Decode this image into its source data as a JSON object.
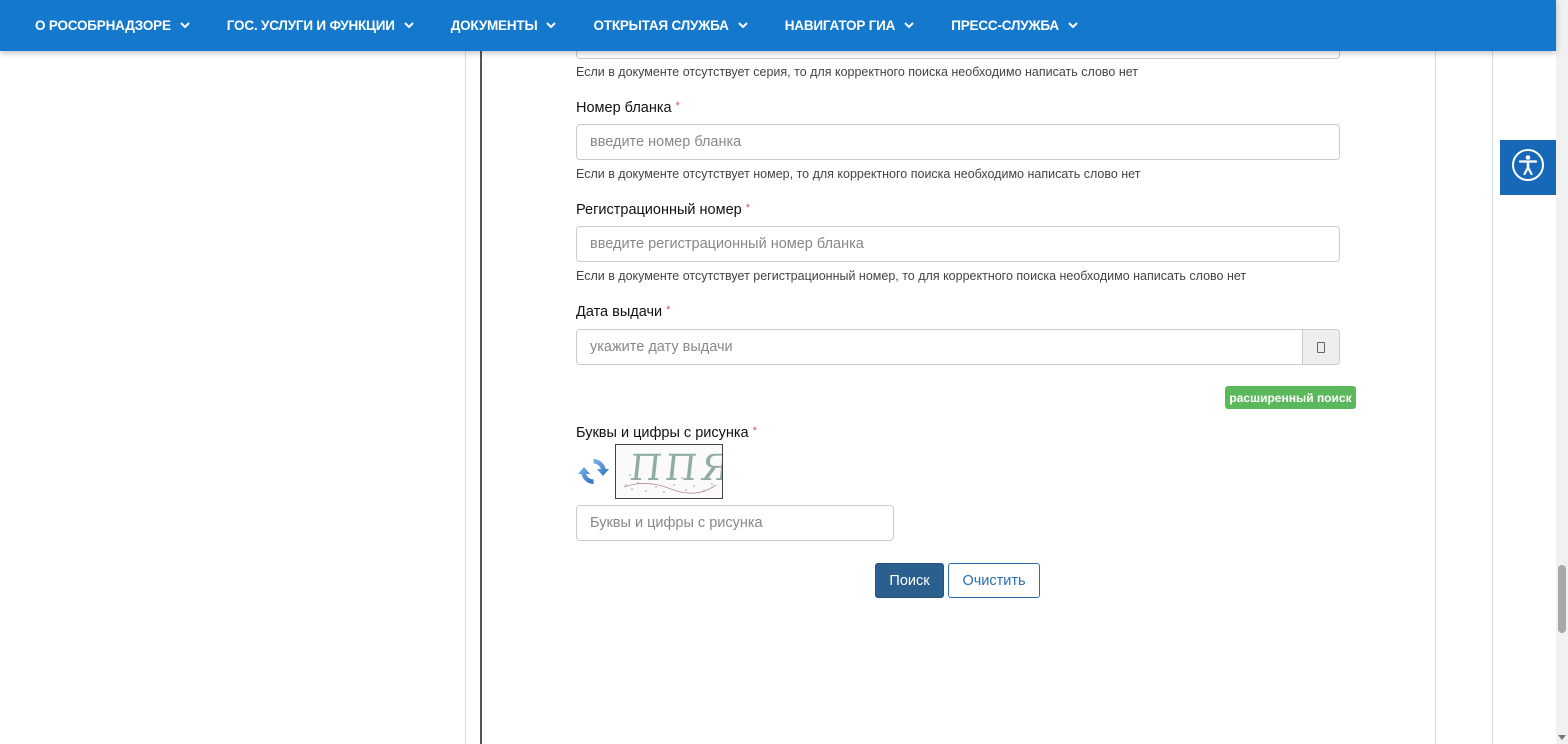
{
  "nav": {
    "items": [
      {
        "label": "О РОСОБРНАДЗОРЕ"
      },
      {
        "label": "ГОС. УСЛУГИ И ФУНКЦИИ"
      },
      {
        "label": "ДОКУМЕНТЫ"
      },
      {
        "label": "ОТКРЫТАЯ СЛУЖБА"
      },
      {
        "label": "НАВИГАТОР ГИА"
      },
      {
        "label": "ПРЕСС-СЛУЖБА"
      }
    ]
  },
  "form": {
    "series_hint": "Если в документе отсутствует серия, то для корректного поиска необходимо написать слово нет",
    "blank_number": {
      "label": "Номер бланка",
      "required_mark": "*",
      "placeholder": "введите номер бланка",
      "hint": "Если в документе отсутствует номер, то для корректного поиска необходимо написать слово нет"
    },
    "reg_number": {
      "label": "Регистрационный номер",
      "required_mark": "*",
      "placeholder": "введите регистрационный номер бланка",
      "hint": "Если в документе отсутствует регистрационный номер, то для корректного поиска необходимо написать слово нет"
    },
    "issue_date": {
      "label": "Дата выдачи",
      "required_mark": "*",
      "placeholder": "укажите дату выдачи"
    },
    "advanced_search_label": "расширенный поиск",
    "captcha": {
      "label": "Буквы и цифры с рисунка",
      "required_mark": "*",
      "placeholder": "Буквы и цифры с рисунка",
      "image_text": "ППЯ"
    },
    "search_button": "Поиск",
    "clear_button": "Очистить"
  },
  "colors": {
    "nav_bg": "#1478cc",
    "accessibility_bg": "#1769b7",
    "advanced_search_bg": "#5cb85c",
    "search_button_bg": "#2a5f8e",
    "required": "#d9534f"
  },
  "icons": {
    "nav_dropdown": "chevron-down-icon",
    "calendar": "calendar-icon",
    "captcha_refresh": "refresh-icon",
    "accessibility": "accessibility-icon"
  }
}
